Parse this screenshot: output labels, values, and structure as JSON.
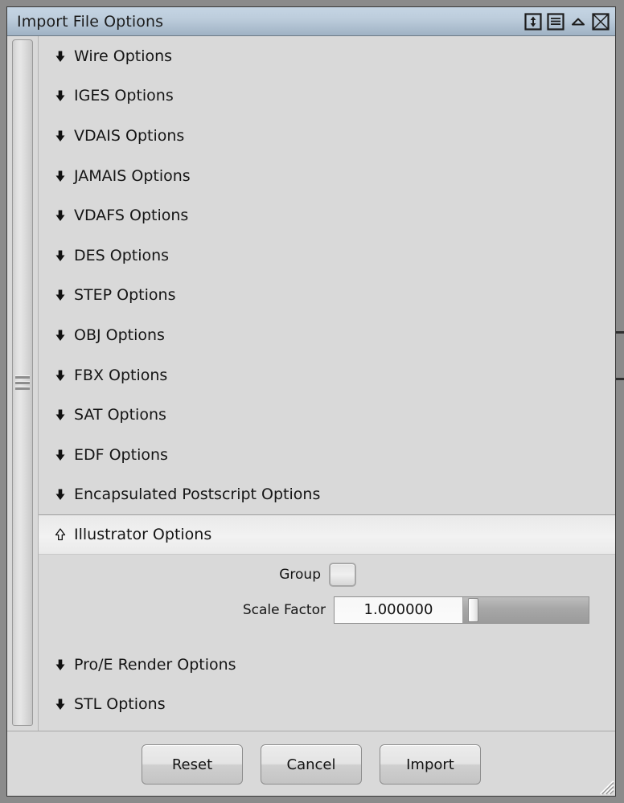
{
  "window": {
    "title": "Import File Options",
    "controls": [
      {
        "name": "resize-vertical-icon",
        "glyph": "updown-arrow"
      },
      {
        "name": "menu-icon",
        "glyph": "lines"
      },
      {
        "name": "collapse-icon",
        "glyph": "triangle-up"
      },
      {
        "name": "close-icon",
        "glyph": "x-box"
      }
    ]
  },
  "colors": {
    "titlebar_top": "#c5d5e4",
    "titlebar_bottom": "#9fb2c4",
    "panel_bg": "#d9d9d9",
    "frame": "#8b8b8b",
    "text": "#151515",
    "selected_row": "#f2f2f2"
  },
  "sections_top": [
    {
      "label": "Wire Options",
      "expanded": false
    },
    {
      "label": "IGES Options",
      "expanded": false
    },
    {
      "label": "VDAIS Options",
      "expanded": false
    },
    {
      "label": "JAMAIS Options",
      "expanded": false
    },
    {
      "label": "VDAFS Options",
      "expanded": false
    },
    {
      "label": "DES Options",
      "expanded": false
    },
    {
      "label": "STEP Options",
      "expanded": false
    },
    {
      "label": "OBJ Options",
      "expanded": false
    },
    {
      "label": "FBX Options",
      "expanded": false
    },
    {
      "label": "SAT Options",
      "expanded": false
    },
    {
      "label": "EDF Options",
      "expanded": false
    },
    {
      "label": "Encapsulated Postscript Options",
      "expanded": false
    }
  ],
  "expanded_section": {
    "label": "Illustrator Options",
    "expanded": true,
    "fields": {
      "group": {
        "label": "Group",
        "checked": false
      },
      "scale_factor": {
        "label": "Scale Factor",
        "value": "1.000000",
        "slider_position_percent": 4
      }
    }
  },
  "sections_bottom": [
    {
      "label": "Pro/E Render Options",
      "expanded": false
    },
    {
      "label": "STL Options",
      "expanded": false
    }
  ],
  "footer": {
    "reset_label": "Reset",
    "cancel_label": "Cancel",
    "import_label": "Import"
  }
}
